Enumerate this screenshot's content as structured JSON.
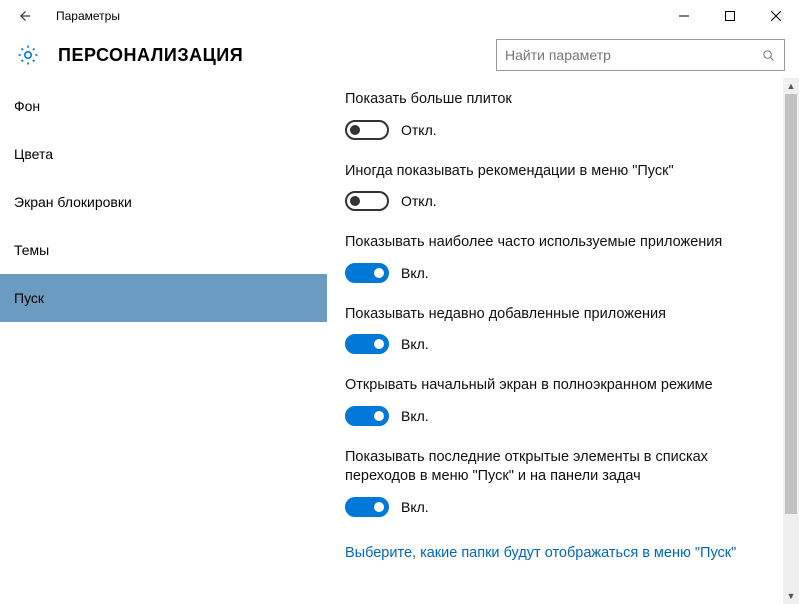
{
  "window": {
    "title": "Параметры"
  },
  "header": {
    "category": "ПЕРСОНАЛИЗАЦИЯ"
  },
  "search": {
    "placeholder": "Найти параметр"
  },
  "sidebar": {
    "items": [
      {
        "label": "Фон"
      },
      {
        "label": "Цвета"
      },
      {
        "label": "Экран блокировки"
      },
      {
        "label": "Темы"
      },
      {
        "label": "Пуск"
      }
    ],
    "selected_index": 4
  },
  "toggle_text": {
    "on": "Вкл.",
    "off": "Откл."
  },
  "settings": [
    {
      "label": "Показать больше плиток",
      "on": false
    },
    {
      "label": "Иногда показывать рекомендации в меню \"Пуск\"",
      "on": false
    },
    {
      "label": "Показывать наиболее часто используемые приложения",
      "on": true
    },
    {
      "label": "Показывать недавно добавленные приложения",
      "on": true
    },
    {
      "label": "Открывать начальный экран в полноэкранном режиме",
      "on": true
    },
    {
      "label": "Показывать последние открытые элементы в списках переходов в меню \"Пуск\" и на панели задач",
      "on": true
    }
  ],
  "link": {
    "label": "Выберите, какие папки будут отображаться в меню \"Пуск\""
  }
}
